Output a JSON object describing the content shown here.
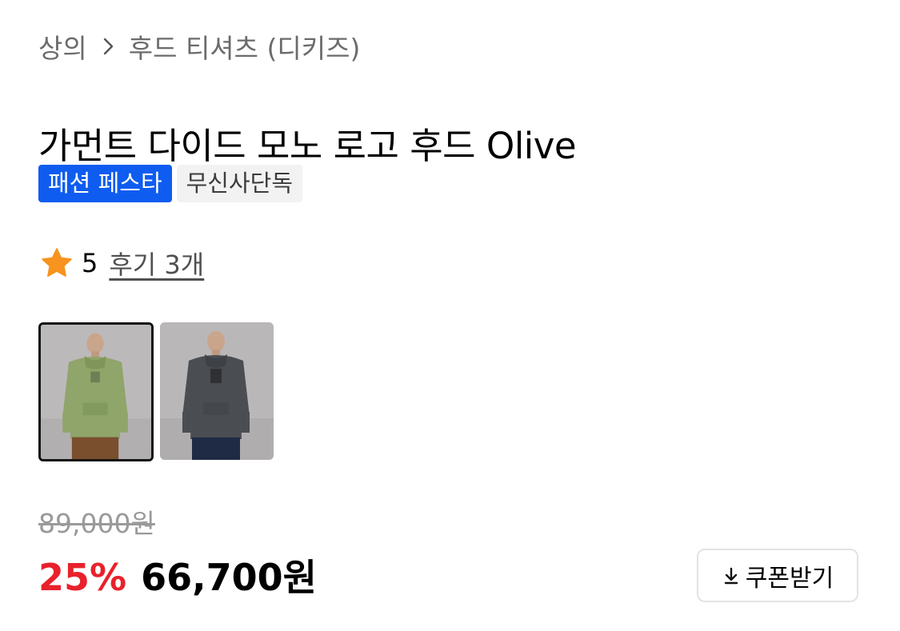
{
  "breadcrumb": {
    "category": "상의",
    "subcategory": "후드 티셔츠 (디키즈)"
  },
  "product": {
    "title": "가먼트 다이드 모노 로고 후드 Olive"
  },
  "tags": [
    {
      "label": "패션 페스타",
      "color": "#0f5cf0"
    },
    {
      "label": "무신사단독"
    }
  ],
  "rating": {
    "score": "5",
    "reviews": "후기 3개",
    "star_color": "#f7931e"
  },
  "thumbnails": [
    {
      "name": "olive-hoodie",
      "hoodie_color": "#8fa56a",
      "selected": true
    },
    {
      "name": "charcoal-hoodie",
      "hoodie_color": "#4a4d52",
      "selected": false
    }
  ],
  "price": {
    "original": "89,000원",
    "discount": "25%",
    "sale": "66,700원",
    "discount_color": "#e8222b"
  },
  "coupon": {
    "label": "쿠폰받기",
    "icon": "download-icon"
  }
}
